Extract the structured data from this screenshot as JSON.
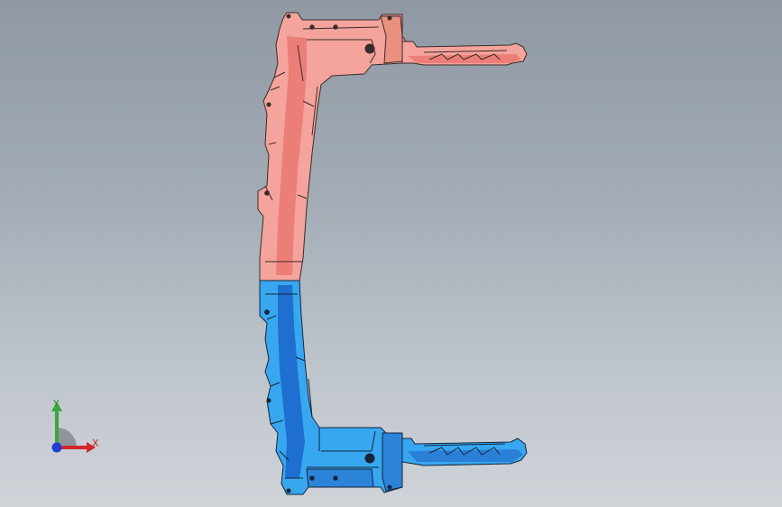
{
  "viewport": {
    "background_top": "#8f98a3",
    "background_bottom": "#d0d4d9"
  },
  "model": {
    "upper_part": {
      "face_color": "#f4a49c",
      "shade_color": "#ec7e78",
      "edge_color": "#3b2a2a"
    },
    "lower_part": {
      "face_color": "#37a8f0",
      "shade_color": "#1e6fd0",
      "edge_color": "#14243a"
    }
  },
  "triad": {
    "x_label": "X",
    "y_label": "Y",
    "x_color": "#d3262b",
    "y_color": "#3aa63d",
    "z_color": "#1f3fd0",
    "icon": "coordinate-triad-icon"
  }
}
